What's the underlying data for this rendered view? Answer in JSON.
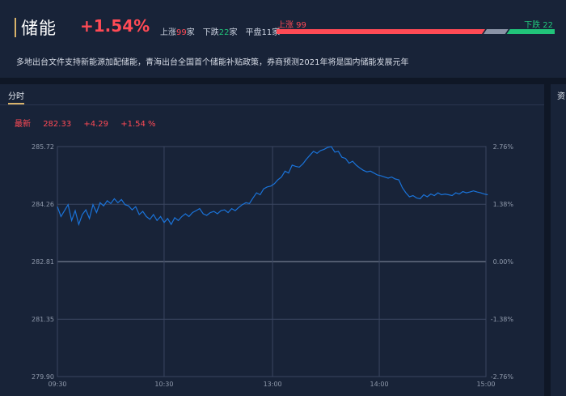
{
  "header": {
    "title": "储能",
    "change_pct": "+1.54%",
    "up_label": "上涨",
    "up_count": "99",
    "up_unit": "家",
    "down_label": "下跌",
    "down_count": "22",
    "down_unit": "家",
    "flat_label": "平盘",
    "flat_count": "11",
    "flat_unit": "家",
    "bar_up_text": "上涨  99",
    "bar_down_text": "下跌  22",
    "colors": {
      "up": "#ff4a55",
      "down": "#21c47a",
      "flat": "#8a93a6"
    },
    "breadth": {
      "up": 99,
      "flat": 11,
      "down": 22
    },
    "description": "多地出台文件支持新能源加配储能，青海出台全国首个储能补贴政策，券商预测2021年将是国内储能发展元年"
  },
  "panel": {
    "tab_label": "分时",
    "latest_label": "最新",
    "latest_value": "282.33",
    "change_value": "+4.29",
    "change_pct": "+1.54 %"
  },
  "side_panel": {
    "tab_label": "资"
  },
  "chart_data": {
    "type": "line",
    "series": [
      {
        "values": [
          [
            0,
            284.2
          ],
          [
            2,
            283.95
          ],
          [
            4,
            284.1
          ],
          [
            6,
            284.25
          ],
          [
            8,
            283.85
          ],
          [
            10,
            284.1
          ],
          [
            12,
            283.75
          ],
          [
            14,
            284.0
          ],
          [
            16,
            284.12
          ],
          [
            18,
            283.9
          ],
          [
            20,
            284.25
          ],
          [
            22,
            284.05
          ],
          [
            24,
            284.3
          ],
          [
            26,
            284.22
          ],
          [
            28,
            284.35
          ],
          [
            30,
            284.28
          ],
          [
            32,
            284.4
          ],
          [
            34,
            284.3
          ],
          [
            36,
            284.38
          ],
          [
            38,
            284.25
          ],
          [
            40,
            284.22
          ],
          [
            42,
            284.12
          ],
          [
            44,
            284.2
          ],
          [
            46,
            284.0
          ],
          [
            48,
            284.08
          ],
          [
            50,
            283.95
          ],
          [
            52,
            283.88
          ],
          [
            54,
            284.0
          ],
          [
            56,
            283.85
          ],
          [
            58,
            283.95
          ],
          [
            60,
            283.8
          ],
          [
            62,
            283.9
          ],
          [
            64,
            283.75
          ],
          [
            66,
            283.92
          ],
          [
            68,
            283.85
          ],
          [
            70,
            283.95
          ],
          [
            72,
            284.02
          ],
          [
            74,
            283.95
          ],
          [
            76,
            284.05
          ],
          [
            78,
            284.1
          ],
          [
            80,
            284.15
          ],
          [
            82,
            284.02
          ],
          [
            84,
            283.98
          ],
          [
            86,
            284.05
          ],
          [
            88,
            284.08
          ],
          [
            90,
            284.02
          ],
          [
            92,
            284.1
          ],
          [
            94,
            284.12
          ],
          [
            96,
            284.05
          ],
          [
            98,
            284.15
          ],
          [
            100,
            284.1
          ],
          [
            102,
            284.18
          ],
          [
            104,
            284.25
          ],
          [
            106,
            284.3
          ],
          [
            108,
            284.28
          ],
          [
            110,
            284.42
          ],
          [
            112,
            284.55
          ],
          [
            114,
            284.5
          ],
          [
            116,
            284.65
          ],
          [
            118,
            284.7
          ],
          [
            120,
            284.72
          ],
          [
            122,
            284.78
          ],
          [
            124,
            284.88
          ],
          [
            126,
            284.95
          ],
          [
            128,
            285.1
          ],
          [
            130,
            285.05
          ],
          [
            132,
            285.25
          ],
          [
            134,
            285.22
          ],
          [
            136,
            285.2
          ],
          [
            138,
            285.28
          ],
          [
            140,
            285.4
          ],
          [
            142,
            285.5
          ],
          [
            144,
            285.6
          ],
          [
            146,
            285.55
          ],
          [
            148,
            285.62
          ],
          [
            150,
            285.65
          ],
          [
            152,
            285.7
          ],
          [
            154,
            285.72
          ],
          [
            156,
            285.58
          ],
          [
            158,
            285.6
          ],
          [
            160,
            285.45
          ],
          [
            162,
            285.42
          ],
          [
            164,
            285.3
          ],
          [
            166,
            285.35
          ],
          [
            168,
            285.25
          ],
          [
            170,
            285.18
          ],
          [
            172,
            285.12
          ],
          [
            174,
            285.08
          ],
          [
            176,
            285.1
          ],
          [
            178,
            285.05
          ],
          [
            180,
            285.0
          ],
          [
            182,
            284.98
          ],
          [
            184,
            284.95
          ],
          [
            186,
            284.92
          ],
          [
            188,
            284.95
          ],
          [
            190,
            284.9
          ],
          [
            192,
            284.88
          ],
          [
            194,
            284.68
          ],
          [
            196,
            284.55
          ],
          [
            198,
            284.45
          ],
          [
            200,
            284.48
          ],
          [
            202,
            284.42
          ],
          [
            204,
            284.4
          ],
          [
            206,
            284.5
          ],
          [
            208,
            284.45
          ],
          [
            210,
            284.52
          ],
          [
            212,
            284.48
          ],
          [
            214,
            284.55
          ],
          [
            216,
            284.5
          ],
          [
            218,
            284.52
          ],
          [
            220,
            284.5
          ],
          [
            222,
            284.48
          ],
          [
            224,
            284.55
          ],
          [
            226,
            284.52
          ],
          [
            228,
            284.58
          ],
          [
            230,
            284.55
          ],
          [
            232,
            284.57
          ],
          [
            234,
            284.6
          ],
          [
            236,
            284.57
          ],
          [
            238,
            284.55
          ],
          [
            240,
            284.52
          ],
          [
            242,
            284.5
          ]
        ]
      }
    ],
    "x_ticks": [
      "09:30",
      "10:30",
      "13:00",
      "14:00",
      "15:00"
    ],
    "x_tick_positions": [
      0,
      60,
      121,
      181,
      241
    ],
    "x_range": [
      0,
      241
    ],
    "ylim": [
      279.9,
      285.72
    ],
    "y_ticks_left": [
      "285.72",
      "284.26",
      "282.81",
      "281.35",
      "279.90"
    ],
    "y_ticks_right": [
      "2.76%",
      "1.38%",
      "0.00%",
      "-1.38%",
      "-2.76%"
    ],
    "y_tick_values": [
      285.72,
      284.26,
      282.81,
      281.35,
      279.9
    ],
    "grid": true,
    "line_color": "#1a73d9",
    "grid_color": "#3a4660",
    "zero_line_color": "#8a93a6"
  }
}
